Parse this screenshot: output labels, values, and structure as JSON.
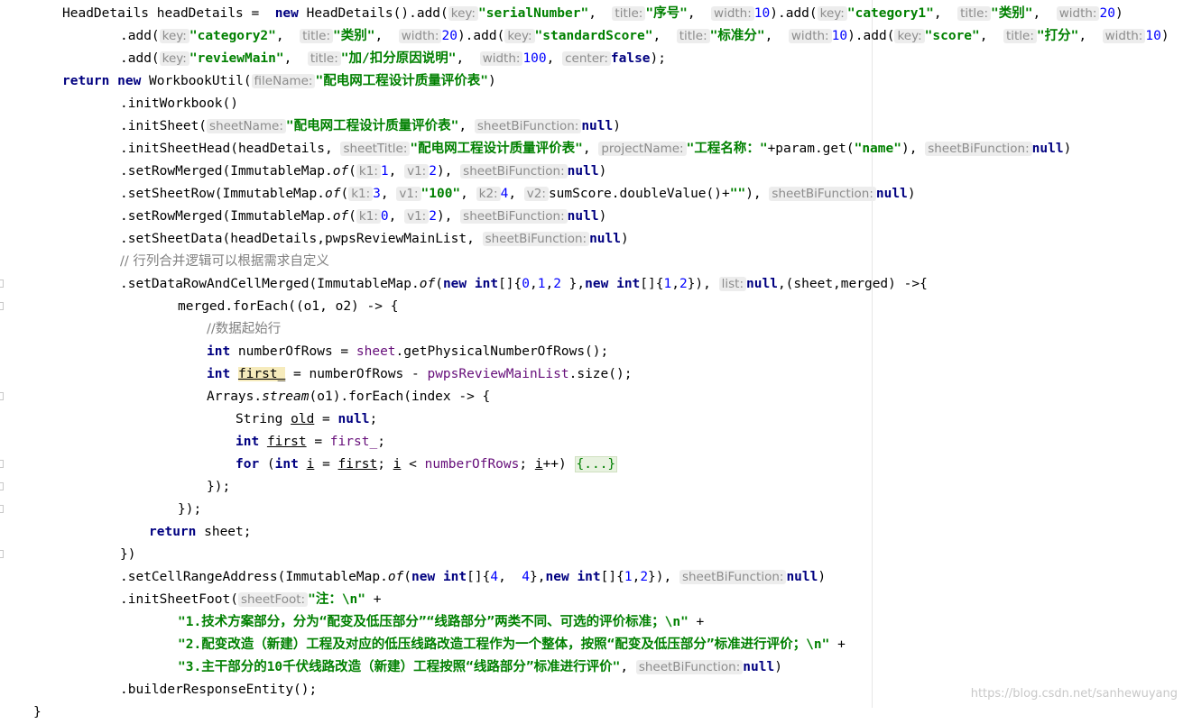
{
  "editor": {
    "watermark": "https://blog.csdn.net/sanhewuyang"
  },
  "code": {
    "l1": {
      "a": "HeadDetails headDetails =  ",
      "kw": "new",
      "b": " HeadDetails().add(",
      "h1": "key:",
      "s1": "\"serialNumber\"",
      "c1": ",  ",
      "h2": "title:",
      "s2": "\"序号\"",
      "c2": ",  ",
      "h3": "width:",
      "n1": "10",
      "c3": ").add(",
      "h4": "key:",
      "s3": "\"category1\"",
      "c4": ",  ",
      "h5": "title:",
      "s4": "\"类别\"",
      "c5": ",  ",
      "h6": "width:",
      "n2": "20",
      "c6": ")"
    },
    "l2": {
      "a": ".add(",
      "h1": "key:",
      "s1": "\"category2\"",
      "c1": ",  ",
      "h2": "title:",
      "s2": "\"类别\"",
      "c2": ",  ",
      "h3": "width:",
      "n1": "20",
      "c3": ").add(",
      "h4": "key:",
      "s3": "\"standardScore\"",
      "c4": ",  ",
      "h5": "title:",
      "s4": "\"标准分\"",
      "c5": ",  ",
      "h6": "width:",
      "n2": "10",
      "c6": ").add(",
      "h7": "key:",
      "s5": "\"score\"",
      "c7": ",  ",
      "h8": "title:",
      "s6": "\"打分\"",
      "c8": ",  ",
      "h9": "width:",
      "n3": "10",
      "c9": ")"
    },
    "l3": {
      "a": ".add(",
      "h1": "key:",
      "s1": "\"reviewMain\"",
      "c1": ",  ",
      "h2": "title:",
      "s2": "\"加/扣分原因说明\"",
      "c2": ",  ",
      "h3": "width:",
      "n1": "100",
      "c3": ", ",
      "h4": "center:",
      "kw": "false",
      "c4": ");"
    },
    "l4": {
      "kw1": "return",
      "a": " ",
      "kw2": "new",
      "b": " WorkbookUtil(",
      "h1": "fileName:",
      "s1": "\"配电网工程设计质量评价表\"",
      "c1": ")"
    },
    "l5": {
      "a": ".initWorkbook()"
    },
    "l6": {
      "a": ".initSheet(",
      "h1": "sheetName:",
      "s1": "\"配电网工程设计质量评价表\"",
      "c1": ", ",
      "h2": "sheetBiFunction:",
      "kw": "null",
      "c2": ")"
    },
    "l7": {
      "a": ".initSheetHead(headDetails, ",
      "h1": "sheetTitle:",
      "s1": "\"配电网工程设计质量评价表\"",
      "c1": ", ",
      "h2": "projectName:",
      "s2": "\"工程名称：\"",
      "c2": "+param.get(",
      "s3": "\"name\"",
      "c3": "), ",
      "h3": "sheetBiFunction:",
      "kw": "null",
      "c4": ")"
    },
    "l8": {
      "a": ".setRowMerged(ImmutableMap.",
      "st": "of",
      "b": "(",
      "h1": "k1:",
      "n1": "1",
      "c1": ", ",
      "h2": "v1:",
      "n2": "2",
      "c2": "), ",
      "h3": "sheetBiFunction:",
      "kw": "null",
      "c3": ")"
    },
    "l9": {
      "a": ".setSheetRow(ImmutableMap.",
      "st": "of",
      "b": "(",
      "h1": "k1:",
      "n1": "3",
      "c1": ", ",
      "h2": "v1:",
      "s1": "\"100\"",
      "c2": ", ",
      "h3": "k2:",
      "n2": "4",
      "c3": ", ",
      "h4": "v2:",
      "c4": "sumScore.doubleValue()+",
      "s2": "\"\"",
      "c5": "), ",
      "h5": "sheetBiFunction:",
      "kw": "null",
      "c6": ")"
    },
    "l10": {
      "a": ".setRowMerged(ImmutableMap.",
      "st": "of",
      "b": "(",
      "h1": "k1:",
      "n1": "0",
      "c1": ", ",
      "h2": "v1:",
      "n2": "2",
      "c2": "), ",
      "h3": "sheetBiFunction:",
      "kw": "null",
      "c3": ")"
    },
    "l11": {
      "a": ".setSheetData(headDetails,pwpsReviewMainList, ",
      "h1": "sheetBiFunction:",
      "kw": "null",
      "c1": ")"
    },
    "l12": {
      "cmt": "// 行列合并逻辑可以根据需求自定义"
    },
    "l13": {
      "a": ".setDataRowAndCellMerged(ImmutableMap.",
      "st": "of",
      "b": "(",
      "kw1": "new",
      "c1": " ",
      "kw2": "int",
      "c2": "[]{",
      "n1": "0",
      "c3": ",",
      "n2": "1",
      "c4": ",",
      "n3": "2",
      "c5": " },",
      "kw3": "new",
      "c6": " ",
      "kw4": "int",
      "c7": "[]{",
      "n4": "1",
      "c8": ",",
      "n5": "2",
      "c9": "}), ",
      "h1": "list:",
      "kw5": "null",
      "c10": ",(sheet,merged) ->{"
    },
    "l14": {
      "a": "merged.forEach((o1, o2) -> {"
    },
    "l15": {
      "cmt": "//数据起始行"
    },
    "l16": {
      "kw": "int",
      "a": " numberOfRows = ",
      "f": "sheet",
      "b": ".getPhysicalNumberOfRows();"
    },
    "l17": {
      "kw": "int",
      "a": " ",
      "v": "first_",
      "b": " = numberOfRows - ",
      "f": "pwpsReviewMainList",
      "c": ".size();"
    },
    "l18": {
      "a": "Arrays.",
      "st": "stream",
      "b": "(o1).forEach(index -> {"
    },
    "l19": {
      "a": "String ",
      "v": "old",
      "b": " = ",
      "kw": "null",
      "c": ";"
    },
    "l20": {
      "kw": "int",
      "a": " ",
      "v": "first",
      "b": " = ",
      "f": "first_",
      "c": ";"
    },
    "l21": {
      "kw1": "for",
      "a": " (",
      "kw2": "int",
      "b": " ",
      "v1": "i",
      "c": " = ",
      "v2": "first",
      "d": "; ",
      "v3": "i",
      "e": " < ",
      "f": "numberOfRows",
      "g": "; ",
      "v4": "i",
      "h": "++) ",
      "fold": "{...}"
    },
    "l22": {
      "a": "});"
    },
    "l23": {
      "a": "});"
    },
    "l24": {
      "kw": "return",
      "a": " sheet;"
    },
    "l25": {
      "a": "})"
    },
    "l26": {
      "a": ".setCellRangeAddress(ImmutableMap.",
      "st": "of",
      "b": "(",
      "kw1": "new",
      "c1": " ",
      "kw2": "int",
      "c2": "[]{",
      "n1": "4",
      "c3": ",  ",
      "n2": "4",
      "c4": "},",
      "kw3": "new",
      "c5": " ",
      "kw4": "int",
      "c6": "[]{",
      "n3": "1",
      "c7": ",",
      "n4": "2",
      "c8": "}), ",
      "h1": "sheetBiFunction:",
      "kw5": "null",
      "c9": ")"
    },
    "l27": {
      "a": ".initSheetFoot(",
      "h1": "sheetFoot:",
      "s1": "\"注：\\n\"",
      "c1": " +"
    },
    "l28": {
      "s1": "\"1.技术方案部分，分为“配变及低压部分”“线路部分”两类不同、可选的评价标准；\\n\"",
      "c1": " +"
    },
    "l29": {
      "s1": "\"2.配变改造（新建）工程及对应的低压线路改造工程作为一个整体，按照“配变及低压部分”标准进行评价；\\n\"",
      "c1": " +"
    },
    "l30": {
      "s1": "\"3.主干部分的10千伏线路改造（新建）工程按照“线路部分”标准进行评价\"",
      "c1": ", ",
      "h1": "sheetBiFunction:",
      "kw": "null",
      "c2": ")"
    },
    "l31": {
      "a": ".builderResponseEntity();"
    },
    "l32": {
      "a": "}"
    }
  }
}
